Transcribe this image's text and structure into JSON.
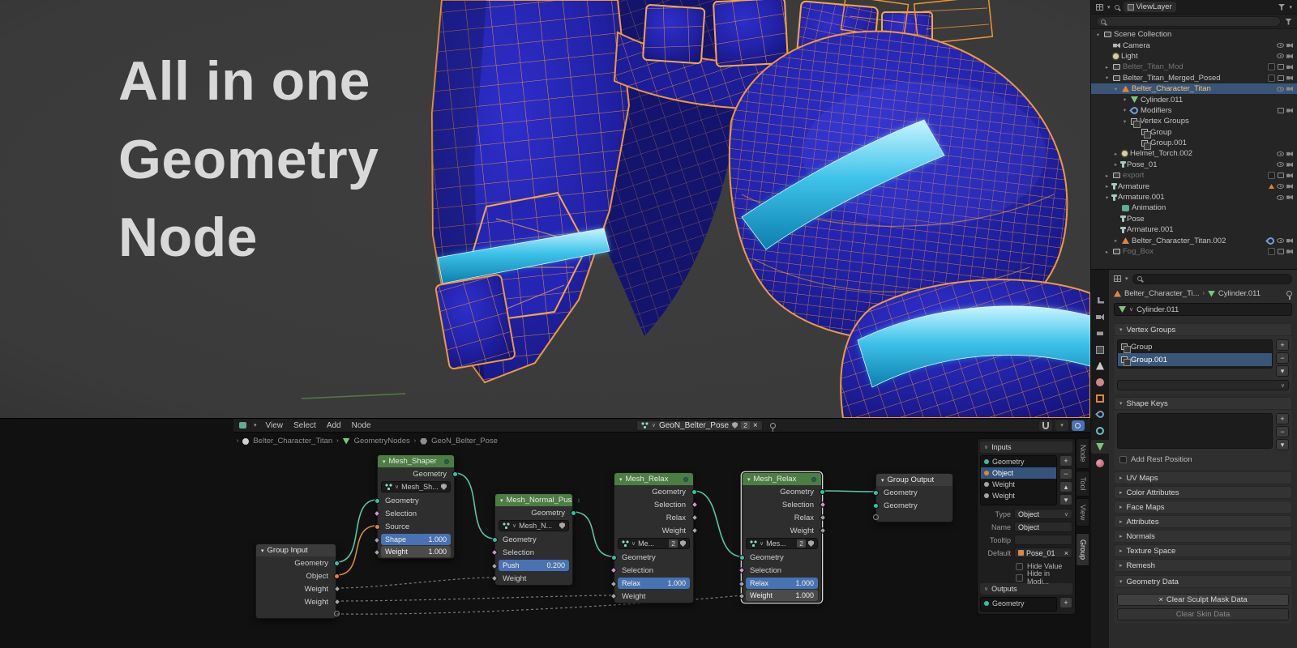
{
  "glyphs": {
    "tri_down": "▾",
    "tri_right": "▸",
    "tri_up": "▴",
    "caret_down": "∨",
    "chevron_sep": "›",
    "plus": "+",
    "minus": "−",
    "close": "×"
  },
  "title": {
    "line1": "All in one",
    "line2": "Geometry",
    "line3": "Node"
  },
  "outliner": {
    "mode_label": "ViewLayer",
    "items": [
      {
        "label": "Scene Collection"
      },
      {
        "label": "Camera"
      },
      {
        "label": "Light"
      },
      {
        "label": "Belter_Titan_Mod"
      },
      {
        "label": "Belter_Titan_Merged_Posed"
      },
      {
        "label": "Belter_Character_Titan"
      },
      {
        "label": "Cylinder.011"
      },
      {
        "label": "Modifiers"
      },
      {
        "label": "Vertex Groups"
      },
      {
        "label": "Group"
      },
      {
        "label": "Group.001"
      },
      {
        "label": "Helmet_Torch.002"
      },
      {
        "label": "Pose_01"
      },
      {
        "label": "export"
      },
      {
        "label": "Armature"
      },
      {
        "label": "Armature.001"
      },
      {
        "label": "Animation"
      },
      {
        "label": "Pose"
      },
      {
        "label": "Armature.001"
      },
      {
        "label": "Belter_Character_Titan.002"
      },
      {
        "label": "Fog_Box"
      }
    ]
  },
  "properties": {
    "breadcrumb_object": "Belter_Character_Ti...",
    "breadcrumb_data": "Cylinder.011",
    "name_field": "Cylinder.011",
    "vertex_groups_title": "Vertex Groups",
    "vertex_groups": [
      {
        "label": "Group"
      },
      {
        "label": "Group.001"
      }
    ],
    "shape_keys_title": "Shape Keys",
    "add_rest_position": "Add Rest Position",
    "sections": [
      {
        "label": "UV Maps"
      },
      {
        "label": "Color Attributes"
      },
      {
        "label": "Face Maps"
      },
      {
        "label": "Attributes"
      },
      {
        "label": "Normals"
      },
      {
        "label": "Texture Space"
      },
      {
        "label": "Remesh"
      },
      {
        "label": "Geometry Data"
      }
    ],
    "clear_sculpt_button": "Clear Sculpt Mask Data",
    "clear_skin_button": "Clear Skin Data"
  },
  "node_editor": {
    "menus": [
      {
        "label": "View"
      },
      {
        "label": "Select"
      },
      {
        "label": "Add"
      },
      {
        "label": "Node"
      }
    ],
    "datablock_name": "GeoN_Belter_Pose",
    "datablock_users": "2",
    "breadcrumb": [
      {
        "label": "Belter_Character_Titan"
      },
      {
        "label": "GeometryNodes"
      },
      {
        "label": "GeoN_Belter_Pose"
      }
    ],
    "nodes": {
      "group_input": {
        "title": "Group Input",
        "outputs": [
          {
            "label": "Geometry"
          },
          {
            "label": "Object"
          },
          {
            "label": "Weight"
          },
          {
            "label": "Weight"
          }
        ]
      },
      "mesh_shaper": {
        "title": "Mesh_Shaper",
        "output": "Geometry",
        "datablock": "Mesh_Sh...",
        "inputs": [
          {
            "label": "Geometry"
          },
          {
            "label": "Selection"
          },
          {
            "label": "Source"
          }
        ],
        "shape_label": "Shape",
        "shape_value": "1.000",
        "weight_label": "Weight",
        "weight_value": "1.000"
      },
      "mesh_normal_push": {
        "title": "Mesh_Normal_Pus",
        "output": "Geometry",
        "datablock": "Mesh_N...",
        "inputs": [
          {
            "label": "Geometry"
          },
          {
            "label": "Selection"
          }
        ],
        "push_label": "Push",
        "push_value": "0.200",
        "weight_label": "Weight"
      },
      "mesh_relax_1": {
        "title": "Mesh_Relax",
        "outputs": [
          {
            "label": "Geometry"
          },
          {
            "label": "Selection"
          },
          {
            "label": "Relax"
          },
          {
            "label": "Weight"
          }
        ],
        "datablock": "Me...",
        "users": "2",
        "inputs": [
          {
            "label": "Geometry"
          },
          {
            "label": "Selection"
          }
        ],
        "relax_label": "Relax",
        "relax_value": "1.000",
        "weight_label": "Weight"
      },
      "mesh_relax_2": {
        "title": "Mesh_Relax",
        "outputs": [
          {
            "label": "Geometry"
          },
          {
            "label": "Selection"
          },
          {
            "label": "Relax"
          },
          {
            "label": "Weight"
          }
        ],
        "datablock": "Mes...",
        "users": "2",
        "inputs": [
          {
            "label": "Geometry"
          },
          {
            "label": "Selection"
          }
        ],
        "relax_label": "Relax",
        "relax_value": "1.000",
        "weight_label": "Weight",
        "weight_value": "1.000"
      },
      "group_output": {
        "title": "Group Output",
        "inputs": [
          {
            "label": "Geometry"
          },
          {
            "label": "Geometry"
          }
        ]
      }
    },
    "sidebar": {
      "inputs_title": "Inputs",
      "input_rows": [
        {
          "label": "Geometry"
        },
        {
          "label": "Object"
        },
        {
          "label": "Weight"
        },
        {
          "label": "Weight"
        }
      ],
      "type_label": "Type",
      "type_value": "Object",
      "name_label": "Name",
      "name_value": "Object",
      "tooltip_label": "Tooltip",
      "default_label": "Default",
      "default_value": "Pose_01",
      "hide_value_label": "Hide Value",
      "hide_in_modifier_label": "Hide in Modi...",
      "outputs_title": "Outputs",
      "output_rows": [
        {
          "label": "Geometry"
        }
      ]
    },
    "tabs": [
      {
        "label": "Node"
      },
      {
        "label": "Tool"
      },
      {
        "label": "View"
      },
      {
        "label": "Group"
      }
    ]
  }
}
